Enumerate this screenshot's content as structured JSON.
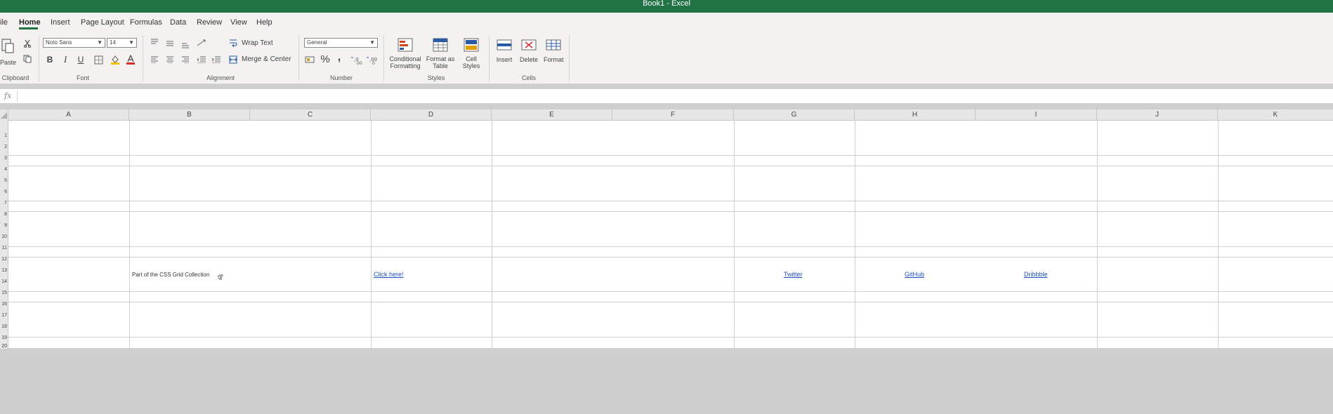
{
  "window": {
    "title": "Book1 - Excel"
  },
  "menu": {
    "items": [
      {
        "label": "ile"
      },
      {
        "label": "Home",
        "active": true
      },
      {
        "label": "Insert"
      },
      {
        "label": "Page Layout"
      },
      {
        "label": "Formulas"
      },
      {
        "label": "Data"
      },
      {
        "label": "Review"
      },
      {
        "label": "View"
      },
      {
        "label": "Help"
      }
    ]
  },
  "ribbon": {
    "clipboard": {
      "paste_label": "Paste",
      "group_label": "Clipboard"
    },
    "font": {
      "family": "Noto Sans",
      "size": "14",
      "bold": "B",
      "italic": "I",
      "underline": "U",
      "group_label": "Font"
    },
    "alignment": {
      "wrap_text": "Wrap Text",
      "merge_center": "Merge & Center",
      "group_label": "Alignment"
    },
    "number": {
      "format": "General",
      "percent": "%",
      "comma": ",",
      "group_label": "Number"
    },
    "styles": {
      "conditional_formatting": "Conditional Formatting",
      "format_as_table": "Format as Table",
      "cell_styles": "Cell Styles",
      "group_label": "Styles"
    },
    "cells": {
      "insert": "Insert",
      "delete": "Delete",
      "format": "Format",
      "group_label": "Cells"
    }
  },
  "formula_bar": {
    "fx_label": "fx",
    "value": ""
  },
  "sheet": {
    "columns": [
      "A",
      "B",
      "C",
      "D",
      "E",
      "F",
      "G",
      "H",
      "I",
      "J",
      "K"
    ],
    "rows": [
      "1",
      "2",
      "3",
      "4",
      "5",
      "6",
      "7",
      "8",
      "9",
      "10",
      "11",
      "12",
      "13",
      "14",
      "15",
      "16",
      "17",
      "18",
      "19",
      "20"
    ],
    "cells": {
      "b_text": "Part of the CSS Grid Collection",
      "d_link": "Click here!",
      "g_link": "Twitter",
      "h_link": "GitHub",
      "i_link": "Dribbble"
    }
  },
  "colors": {
    "brand": "#217346",
    "link": "#1f4fbf"
  }
}
